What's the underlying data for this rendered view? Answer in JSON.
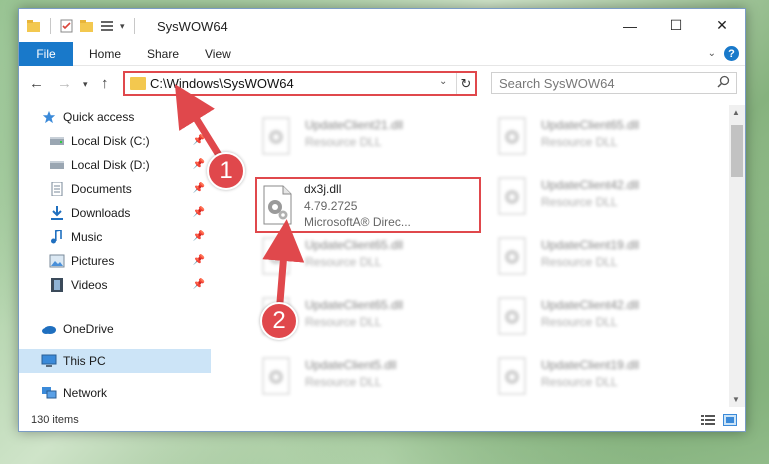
{
  "window": {
    "title": "SysWOW64",
    "minimize": "—",
    "maximize": "☐",
    "close": "✕"
  },
  "ribbon": {
    "file": "File",
    "home": "Home",
    "share": "Share",
    "view": "View"
  },
  "address": {
    "path": "C:\\Windows\\SysWOW64",
    "search_placeholder": "Search SysWOW64"
  },
  "sidebar": {
    "items": [
      {
        "label": "Quick access",
        "icon": "star-icon"
      },
      {
        "label": "Local Disk (C:)",
        "icon": "drive-icon"
      },
      {
        "label": "Local Disk (D:)",
        "icon": "drive-icon"
      },
      {
        "label": "Documents",
        "icon": "documents-icon"
      },
      {
        "label": "Downloads",
        "icon": "downloads-icon"
      },
      {
        "label": "Music",
        "icon": "music-icon"
      },
      {
        "label": "Pictures",
        "icon": "pictures-icon"
      },
      {
        "label": "Videos",
        "icon": "videos-icon"
      },
      {
        "label": "OneDrive",
        "icon": "cloud-icon"
      },
      {
        "label": "This PC",
        "icon": "computer-icon"
      },
      {
        "label": "Network",
        "icon": "network-icon"
      }
    ]
  },
  "files": {
    "highlighted": {
      "name": "dx3j.dll",
      "version": "4.79.2725",
      "company": "MicrosoftA® Direc..."
    },
    "background": [
      {
        "name": "UpdateClient21.dll",
        "desc": "Resource DLL"
      },
      {
        "name": "UpdateClient65.dll",
        "desc": "Resource DLL"
      },
      {
        "name": "UpdateClient42.dll",
        "desc": "Resource DLL"
      },
      {
        "name": "UpdateClient65.dll",
        "desc": "Resource DLL"
      },
      {
        "name": "UpdateClient19.dll",
        "desc": "Resource DLL"
      },
      {
        "name": "UpdateClient65.dll",
        "desc": "Resource DLL"
      },
      {
        "name": "UpdateClient42.dll",
        "desc": "Resource DLL"
      },
      {
        "name": "UpdateClient5.dll",
        "desc": "Resource DLL"
      },
      {
        "name": "UpdateClient19.dll",
        "desc": "Resource DLL"
      }
    ]
  },
  "status": {
    "count": "130 items"
  },
  "annotations": {
    "step1": "1",
    "step2": "2",
    "color": "#e0484c"
  }
}
